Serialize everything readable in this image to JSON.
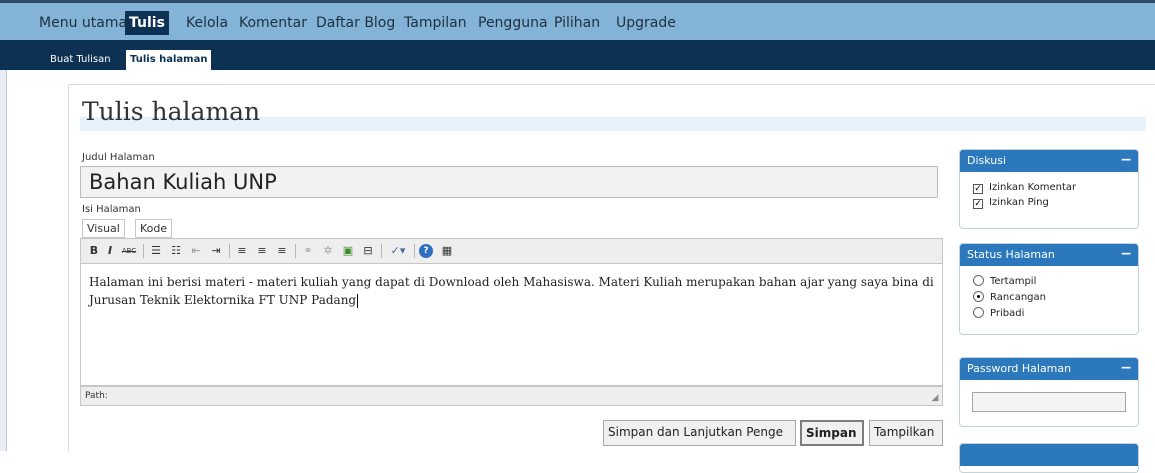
{
  "topnav": {
    "items": [
      {
        "label": "Menu utama",
        "active": false
      },
      {
        "label": "Tulis",
        "active": true
      },
      {
        "label": "Kelola",
        "active": false
      },
      {
        "label": "Komentar",
        "active": false
      },
      {
        "label": "Daftar Blog",
        "active": false
      },
      {
        "label": "Tampilan",
        "active": false
      },
      {
        "label": "Pengguna",
        "active": false
      },
      {
        "label": "Pilihan",
        "active": false
      },
      {
        "label": "Upgrade",
        "active": false
      }
    ]
  },
  "subnav": {
    "items": [
      {
        "label": "Buat Tulisan",
        "active": false
      },
      {
        "label": "Tulis halaman",
        "active": true
      }
    ]
  },
  "page": {
    "title": "Tulis halaman"
  },
  "form": {
    "title_label": "Judul Halaman",
    "title_value": "Bahan Kuliah UNP",
    "content_label": "Isi Halaman",
    "tabs": [
      "Visual",
      "Kode"
    ],
    "content": "Halaman ini berisi materi - materi kuliah yang dapat di Download oleh Mahasiswa. Materi Kuliah merupakan bahan ajar yang saya bina di Jurusan Teknik Elektornika FT UNP Padang",
    "path_label": "Path:"
  },
  "toolbar": {
    "bold": "B",
    "italic": "I",
    "strike": "ABC",
    "help": "?",
    "icons": [
      "bold-icon",
      "italic-icon",
      "strikethrough-icon",
      "bullet-list-icon",
      "numbered-list-icon",
      "outdent-icon",
      "indent-icon",
      "align-left-icon",
      "align-center-icon",
      "align-right-icon",
      "link-icon",
      "unlink-icon",
      "image-icon",
      "more-break-icon",
      "spellcheck-icon",
      "help-icon",
      "kitchen-sink-icon"
    ]
  },
  "buttons": {
    "save_continue": "Simpan dan Lanjutkan Penge",
    "save": "Simpan",
    "preview": "Tampilkan"
  },
  "sidebar": {
    "discussion": {
      "title": "Diskusi",
      "options": [
        {
          "label": "Izinkan Komentar",
          "checked": true
        },
        {
          "label": "Izinkan Ping",
          "checked": true
        }
      ]
    },
    "status": {
      "title": "Status Halaman",
      "options": [
        {
          "label": "Tertampil",
          "selected": false
        },
        {
          "label": "Rancangan",
          "selected": true
        },
        {
          "label": "Pribadi",
          "selected": false
        }
      ]
    },
    "password": {
      "title": "Password Halaman",
      "value": ""
    }
  },
  "colors": {
    "topnav_bg": "#83b4d8",
    "subnav_bg": "#0d3152",
    "box_header": "#2c78bd",
    "title_band": "#e6f1fa"
  }
}
